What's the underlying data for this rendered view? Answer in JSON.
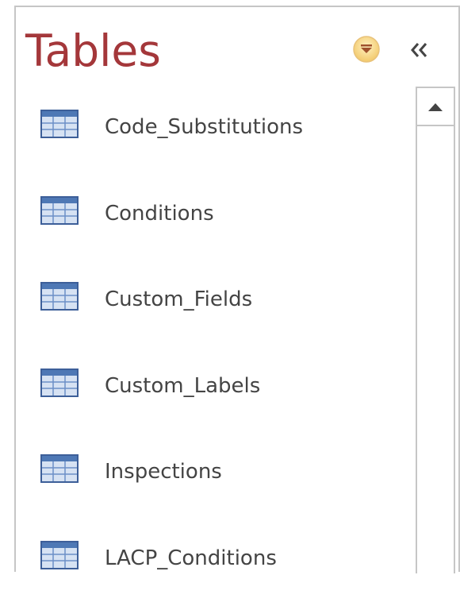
{
  "pane": {
    "title": "Tables",
    "title_color": "#a4373a",
    "menu_icon": "dropdown-circle-icon",
    "collapse_icon": "double-chevron-left-icon",
    "collapse_glyph": "«",
    "items": [
      {
        "label": "Code_Substitutions",
        "icon": "table-icon"
      },
      {
        "label": "Conditions",
        "icon": "table-icon"
      },
      {
        "label": "Custom_Fields",
        "icon": "table-icon"
      },
      {
        "label": "Custom_Labels",
        "icon": "table-icon"
      },
      {
        "label": "Inspections",
        "icon": "table-icon"
      },
      {
        "label": "LACP_Conditions",
        "icon": "table-icon"
      }
    ]
  },
  "scrollbar": {
    "up_icon": "scroll-up-arrow-icon"
  }
}
